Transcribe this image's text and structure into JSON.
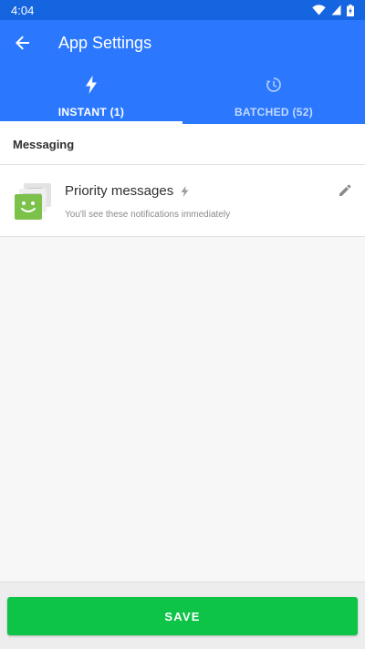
{
  "status_bar": {
    "time": "4:04",
    "icons": [
      "wifi-icon",
      "signal-icon",
      "battery-charging-icon"
    ]
  },
  "app_bar": {
    "title": "App Settings",
    "back_icon": "arrow-back-icon"
  },
  "tabs": [
    {
      "label": "INSTANT (1)",
      "icon": "lightning-icon",
      "active": true
    },
    {
      "label": "BATCHED (52)",
      "icon": "history-icon",
      "active": false
    }
  ],
  "section": {
    "title": "Messaging"
  },
  "items": [
    {
      "title": "Priority messages",
      "subtitle": "You'll see these notifications immediately",
      "icon": "message-app-icon",
      "badge_icon": "lightning-small-icon",
      "action_icon": "edit-pencil-icon"
    }
  ],
  "footer": {
    "save_label": "SAVE"
  },
  "colors": {
    "primary": "#2b78ff",
    "status_bar": "#1565e0",
    "save": "#0dc447",
    "avatar": "#7cc24a"
  }
}
